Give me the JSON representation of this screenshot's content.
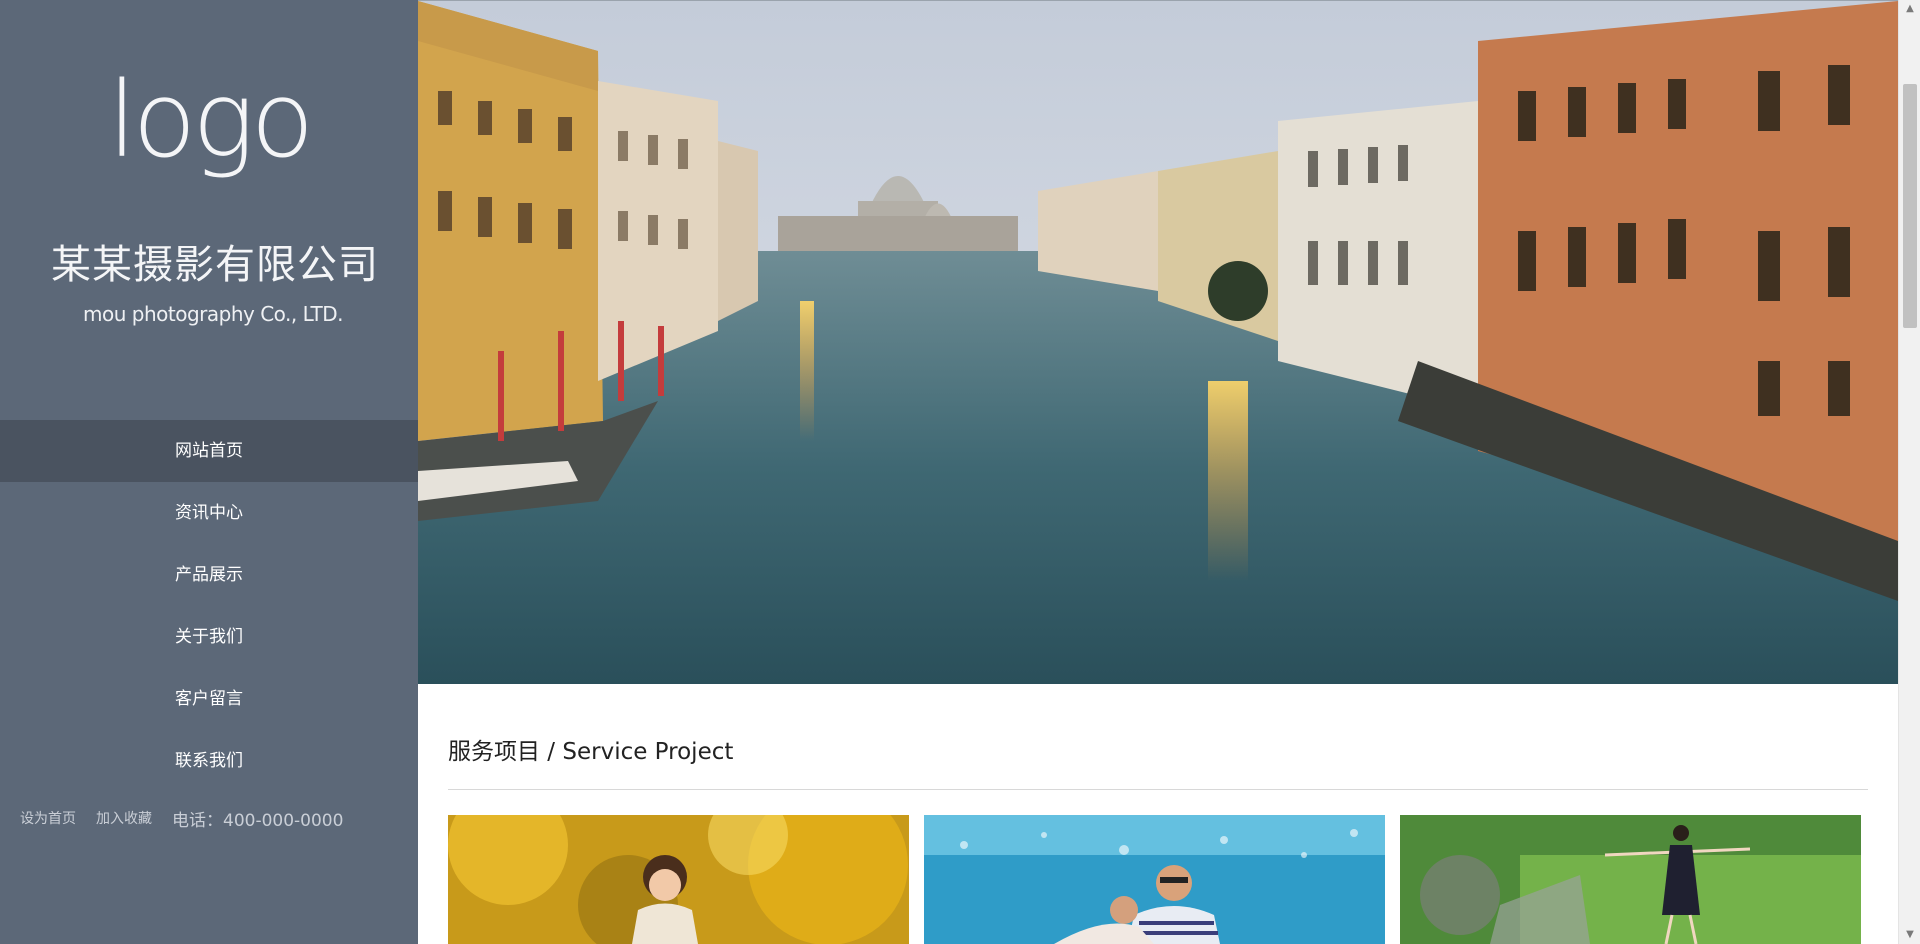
{
  "sidebar": {
    "logo_text": "logo",
    "company_name_cn": "某某摄影有限公司",
    "company_name_en": "mou photography  Co., LTD.",
    "nav": [
      {
        "label": "网站首页",
        "active": true
      },
      {
        "label": "资讯中心",
        "active": false
      },
      {
        "label": "产品展示",
        "active": false
      },
      {
        "label": "关于我们",
        "active": false
      },
      {
        "label": "客户留言",
        "active": false
      },
      {
        "label": "联系我们",
        "active": false
      }
    ],
    "footer": {
      "set_home": "设为首页",
      "add_favorite": "加入收藏",
      "phone": "电话：400-000-0000"
    }
  },
  "hero": {
    "image_icon": "venice-canal-photo"
  },
  "services": {
    "title": "服务项目 / Service Project",
    "items": [
      {
        "icon": "child-autumn-photo"
      },
      {
        "icon": "couple-beach-photo"
      },
      {
        "icon": "girl-garden-photo"
      }
    ]
  },
  "colors": {
    "sidebar_bg": "#5c6878",
    "nav_active_bg": "#4a5360",
    "text_light": "#ffffff"
  }
}
